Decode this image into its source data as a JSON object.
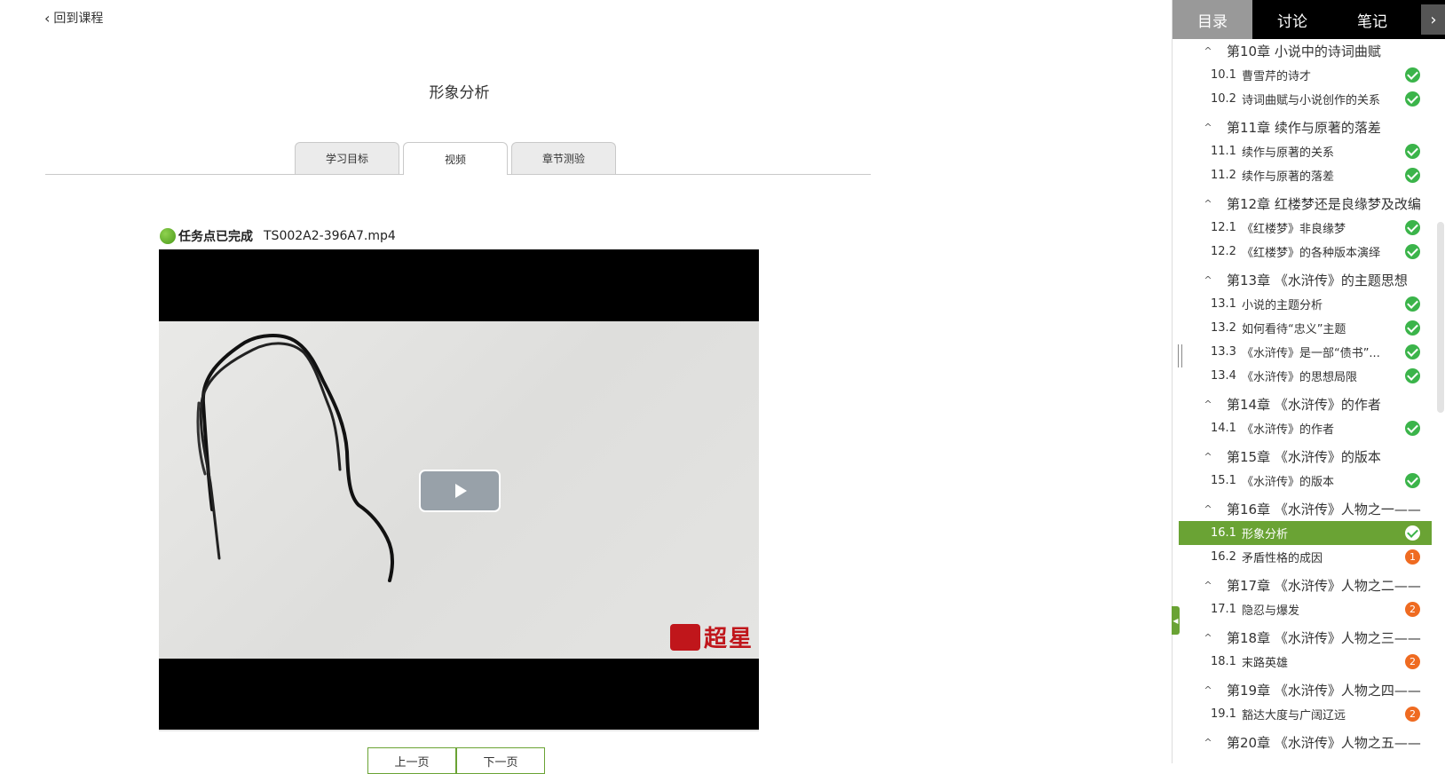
{
  "nav": {
    "back_label": "回到课程"
  },
  "page": {
    "title": "形象分析"
  },
  "tabs": [
    {
      "label": "学习目标"
    },
    {
      "label": "视频"
    },
    {
      "label": "章节测验"
    }
  ],
  "task": {
    "status": "任务点已完成",
    "filename": "TS002A2-396A7.mp4"
  },
  "video": {
    "watermark": "超星"
  },
  "pager": {
    "prev": "上一页",
    "next": "下一页"
  },
  "sidebar": {
    "tabs": [
      {
        "label": "目录"
      },
      {
        "label": "讨论"
      },
      {
        "label": "笔记"
      }
    ],
    "toggle": "›",
    "chapters": [
      {
        "title": "第10章 小说中的诗词曲赋",
        "sections": [
          {
            "num": "10.1",
            "title": "曹雪芹的诗才",
            "status": "done",
            "count": ""
          },
          {
            "num": "10.2",
            "title": "诗词曲赋与小说创作的关系",
            "status": "done",
            "count": ""
          }
        ]
      },
      {
        "title": "第11章 续作与原著的落差",
        "sections": [
          {
            "num": "11.1",
            "title": "续作与原著的关系",
            "status": "done",
            "count": ""
          },
          {
            "num": "11.2",
            "title": "续作与原著的落差",
            "status": "done",
            "count": ""
          }
        ]
      },
      {
        "title": "第12章 红楼梦还是良缘梦及改编",
        "sections": [
          {
            "num": "12.1",
            "title": "《红楼梦》非良缘梦",
            "status": "done",
            "count": ""
          },
          {
            "num": "12.2",
            "title": "《红楼梦》的各种版本演绎",
            "status": "done",
            "count": ""
          }
        ]
      },
      {
        "title": "第13章 《水浒传》的主题思想",
        "sections": [
          {
            "num": "13.1",
            "title": "小说的主题分析",
            "status": "done",
            "count": ""
          },
          {
            "num": "13.2",
            "title": "如何看待“忠义”主题",
            "status": "done",
            "count": ""
          },
          {
            "num": "13.3",
            "title": "《水浒传》是一部“债书”...",
            "status": "done",
            "count": ""
          },
          {
            "num": "13.4",
            "title": "《水浒传》的思想局限",
            "status": "done",
            "count": ""
          }
        ]
      },
      {
        "title": "第14章 《水浒传》的作者",
        "sections": [
          {
            "num": "14.1",
            "title": "《水浒传》的作者",
            "status": "done",
            "count": ""
          }
        ]
      },
      {
        "title": "第15章 《水浒传》的版本",
        "sections": [
          {
            "num": "15.1",
            "title": "《水浒传》的版本",
            "status": "done",
            "count": ""
          }
        ]
      },
      {
        "title": "第16章 《水浒传》人物之一——",
        "sections": [
          {
            "num": "16.1",
            "title": "形象分析",
            "status": "done",
            "count": "",
            "active": true
          },
          {
            "num": "16.2",
            "title": "矛盾性格的成因",
            "status": "count",
            "count": "1"
          }
        ]
      },
      {
        "title": "第17章 《水浒传》人物之二——",
        "sections": [
          {
            "num": "17.1",
            "title": "隐忍与爆发",
            "status": "count",
            "count": "2"
          }
        ]
      },
      {
        "title": "第18章 《水浒传》人物之三——",
        "sections": [
          {
            "num": "18.1",
            "title": "末路英雄",
            "status": "count",
            "count": "2"
          }
        ]
      },
      {
        "title": "第19章 《水浒传》人物之四——",
        "sections": [
          {
            "num": "19.1",
            "title": "豁达大度与广阔辽远",
            "status": "count",
            "count": "2"
          }
        ]
      },
      {
        "title": "第20章 《水浒传》人物之五——",
        "sections": []
      }
    ]
  },
  "colors": {
    "accent": "#6aa334",
    "done": "#3bb44a",
    "pending": "#ef6b21"
  }
}
